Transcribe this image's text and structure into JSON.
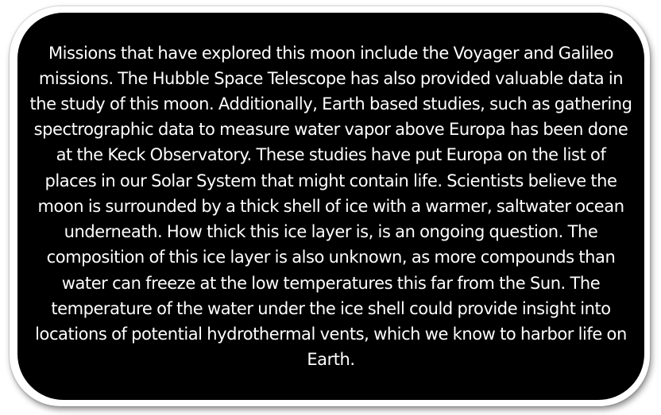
{
  "card": {
    "paragraph": "Missions that have explored this moon include the Voyager and Galileo missions. The Hubble Space Telescope has also provided valuable data in the study of this moon.  Additionally, Earth based studies, such as gathering spectrographic data to measure water vapor above Europa has been done at the Keck Observatory. These studies have put Europa on the list of places in our Solar System that might contain life. Scientists believe the moon is surrounded by a thick shell of ice with a warmer, saltwater ocean underneath.  How thick this ice layer is, is an ongoing question. The composition of this ice layer is also unknown, as more compounds than water can freeze at the low temperatures this far from the Sun. The temperature of the water under the ice shell could provide insight into locations of potential hydrothermal vents, which we know to harbor life on Earth.",
    "background_color": "#000000",
    "text_color": "#ffffff",
    "border_color": "#ffffff"
  }
}
